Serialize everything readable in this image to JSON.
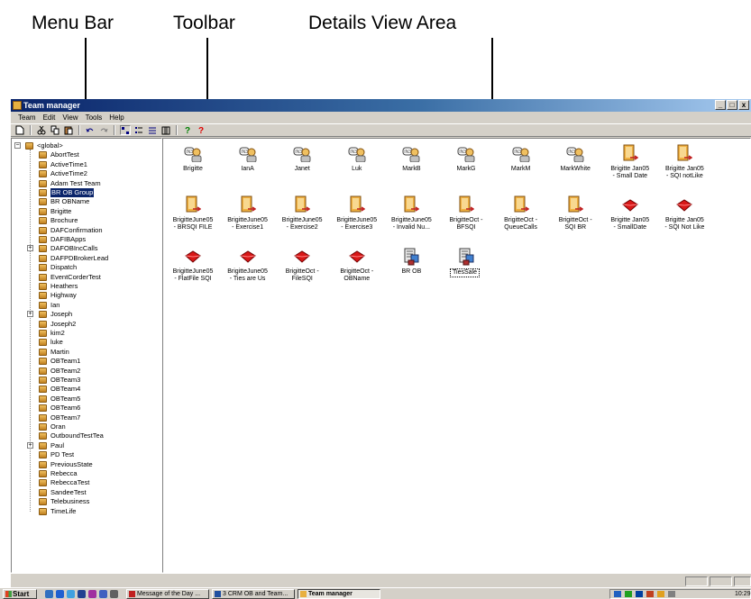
{
  "annotations": {
    "menu_bar": "Menu Bar",
    "toolbar": "Toolbar",
    "details_view_area": "Details View Area"
  },
  "window": {
    "title": "Team manager",
    "controls": [
      "_",
      "□",
      "x"
    ]
  },
  "menu": [
    "Team",
    "Edit",
    "View",
    "Tools",
    "Help"
  ],
  "toolbar_icons": [
    "new-icon",
    "cut-icon",
    "copy-icon",
    "paste-icon",
    "undo-icon",
    "redo-icon",
    "large-icons-view-icon",
    "small-icons-view-icon",
    "list-view-icon",
    "details-view-icon",
    "help-icon",
    "whats-this-icon"
  ],
  "tree": {
    "root": "<global>",
    "items": [
      "AbortTest",
      "ActiveTime1",
      "ActiveTime2",
      "Adam Test Team",
      "BR OB Group",
      "BR OBName",
      "Brigitte",
      "Brochure",
      "DAFConfirmation",
      "DAFIBApps",
      "DAFOBIncCalls",
      "DAFPDBrokerLead",
      "Dispatch",
      "EventCorderTest",
      "Heathers",
      "Highway",
      "Ian",
      "Joseph",
      "Joseph2",
      "kim2",
      "luke",
      "Martin",
      "OBTeam1",
      "OBTeam2",
      "OBTeam3",
      "OBTeam4",
      "OBTeam5",
      "OBTeam6",
      "OBTeam7",
      "Oran",
      "OutboundTestTea",
      "Paul",
      "PD Test",
      "PreviousState",
      "Rebecca",
      "RebeccaTest",
      "SandeeTest",
      "Telebusiness",
      "TimeLife"
    ],
    "selected": "BR OB Group",
    "expandable": [
      "DAFOBIncCalls",
      "Joseph",
      "Paul"
    ]
  },
  "details": {
    "rows": [
      [
        {
          "label": "Brigitte",
          "icon": "agent-headset-icon"
        },
        {
          "label": "IanA",
          "icon": "agent-headset-icon"
        },
        {
          "label": "Janet",
          "icon": "agent-headset-icon"
        },
        {
          "label": "Luk",
          "icon": "agent-headset-icon"
        },
        {
          "label": "MarkB",
          "icon": "agent-headset-icon"
        },
        {
          "label": "MarkG",
          "icon": "agent-headset-icon"
        },
        {
          "label": "MarkM",
          "icon": "agent-headset-icon"
        },
        {
          "label": "MarkWhite",
          "icon": "agent-headset-icon"
        },
        {
          "label": "Brigitte Jan05\n- Small Date",
          "icon": "campaign-document-icon"
        },
        {
          "label": "Brigitte Jan05\n- SQI notLike",
          "icon": "campaign-document-icon"
        }
      ],
      [
        {
          "label": "BrigitteJune05\n- BRSQI FILE",
          "icon": "campaign-document-icon"
        },
        {
          "label": "BrigitteJune05\n- Exercise1",
          "icon": "campaign-document-icon"
        },
        {
          "label": "BrigitteJune05\n- Exercise2",
          "icon": "campaign-document-icon"
        },
        {
          "label": "BrigitteJune05\n- Exercise3",
          "icon": "campaign-document-icon"
        },
        {
          "label": "BrigitteJune05\n- Invalid Nu...",
          "icon": "campaign-document-icon"
        },
        {
          "label": "BrigitteOct -\nBFSQI",
          "icon": "campaign-document-icon"
        },
        {
          "label": "BrigitteOct -\nQueueCalls",
          "icon": "campaign-document-icon"
        },
        {
          "label": "BrigitteOct -\nSQI BR",
          "icon": "campaign-document-icon"
        },
        {
          "label": "Brigitte Jan05\n- SmallDate",
          "icon": "red-gem-icon"
        },
        {
          "label": "Brigitte Jan05\n- SQI Not Like",
          "icon": "red-gem-icon"
        }
      ],
      [
        {
          "label": "BrigitteJune05\n- FlatFile SQI",
          "icon": "red-gem-icon"
        },
        {
          "label": "BrigitteJune05\n- Ties are Us",
          "icon": "red-gem-icon"
        },
        {
          "label": "BrigitteOct -\nFileSQI",
          "icon": "red-gem-icon"
        },
        {
          "label": "BrigitteOct -\nOBName",
          "icon": "red-gem-icon"
        },
        {
          "label": "BR OB",
          "icon": "server-document-icon"
        },
        {
          "label": "TiesSale",
          "icon": "server-document-icon",
          "boxed": true
        }
      ]
    ]
  },
  "taskbar": {
    "start_label": "Start",
    "tasks": [
      {
        "label": "Message of the Day ...",
        "active": false
      },
      {
        "label": "3 CRM OB and Team...",
        "active": false
      },
      {
        "label": "Team manager",
        "active": true
      }
    ],
    "clock": "10:29"
  },
  "colors": {
    "titlebar_start": "#0a246a",
    "titlebar_end": "#a6caf0",
    "window_face": "#d4d0c8",
    "selection": "#0a246a"
  }
}
